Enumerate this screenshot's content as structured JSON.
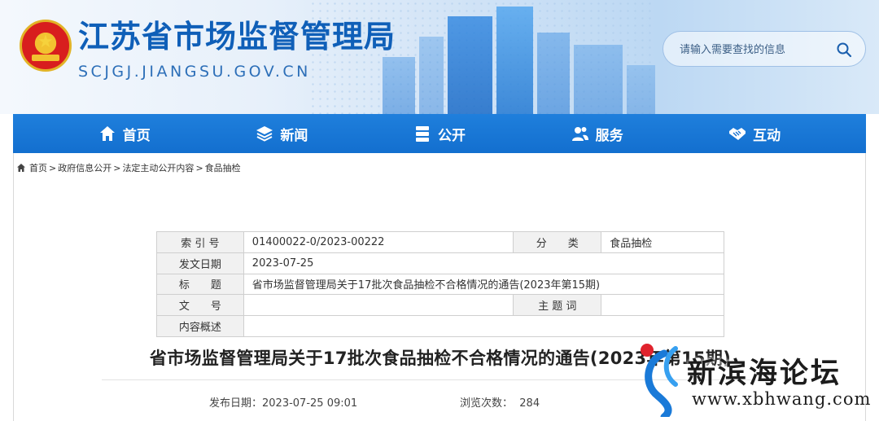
{
  "header": {
    "site_title": "江苏省市场监督管理局",
    "site_domain": "SCJGJ.JIANGSU.GOV.CN",
    "search_placeholder": "请输入需要查找的信息"
  },
  "nav": {
    "items": [
      {
        "label": "首页",
        "icon": "home-icon"
      },
      {
        "label": "新闻",
        "icon": "layers-icon"
      },
      {
        "label": "公开",
        "icon": "stack-icon"
      },
      {
        "label": "服务",
        "icon": "people-icon"
      },
      {
        "label": "互动",
        "icon": "handshake-icon"
      }
    ]
  },
  "breadcrumb": {
    "items": [
      "首页",
      "政府信息公开",
      "法定主动公开内容",
      "食品抽检"
    ],
    "separator": ">"
  },
  "info_table": {
    "index_label": "索 引 号",
    "index_value": "01400022-0/2023-00222",
    "category_label": "分　　类",
    "category_value": "食品抽检",
    "date_label": "发文日期",
    "date_value": "2023-07-25",
    "subject_label": "标　　题",
    "subject_value": "省市场监督管理局关于17批次食品抽检不合格情况的通告(2023年第15期)",
    "docno_label": "文　　号",
    "docno_value": "",
    "keyword_label": "主 题 词",
    "keyword_value": "",
    "summary_label": "内容概述",
    "summary_value": ""
  },
  "article": {
    "title": "省市场监督管理局关于17批次食品抽检不合格情况的通告(2023年第15期)",
    "publish_label": "发布日期：",
    "publish_value": "2023-07-25 09:01",
    "views_label": "浏览次数：",
    "views_value": "284"
  },
  "watermark": {
    "name": "新滨海论坛",
    "url": "www.xbhwang.com"
  },
  "colors": {
    "brand_blue": "#136fcf",
    "title_blue": "#0f5fb8",
    "emblem_red": "#d81e1e",
    "emblem_gold": "#f2c230"
  }
}
